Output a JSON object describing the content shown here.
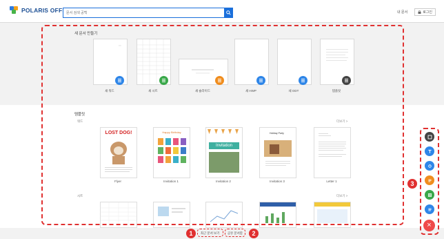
{
  "header": {
    "logo_text": "POLARIS OFFICE",
    "search_placeholder": "문서 검색 공백",
    "notifications_label": "내 문서",
    "login_label": "로그인"
  },
  "new_docs": {
    "title": "새 문서 만들기",
    "items": [
      {
        "label": "새 워드",
        "color": "#2f86e8"
      },
      {
        "label": "새 시트",
        "color": "#3aa84a"
      },
      {
        "label": "새 슬라이드",
        "color": "#f08d1e"
      },
      {
        "label": "새 HWP",
        "color": "#2f86e8"
      },
      {
        "label": "새 ODT",
        "color": "#2f86e8"
      },
      {
        "label": "템플릿",
        "color": "#444444"
      }
    ]
  },
  "templates": {
    "title": "템플릿",
    "group1": {
      "name": "워드",
      "more": "더보기 >",
      "items": [
        {
          "label": "Flyer",
          "headline": "LOST DOG!"
        },
        {
          "label": "Invitation 1",
          "headline": "Happy Birthday"
        },
        {
          "label": "Invitation 2",
          "headline": "Invitation"
        },
        {
          "label": "Invitation 3",
          "headline": "Holiday Party"
        },
        {
          "label": "Letter 1",
          "headline": ""
        }
      ]
    },
    "group2": {
      "name": "시트",
      "more": "더보기 >"
    }
  },
  "bottom": {
    "link1": "최근 문서 보기",
    "link2": "공유 문서함"
  },
  "markers": {
    "m1": "1",
    "m2": "2",
    "m3": "3"
  },
  "fab": {
    "items": [
      {
        "name": "template",
        "color": "#444444"
      },
      {
        "name": "odt",
        "color": "#2f86e8"
      },
      {
        "name": "hwp",
        "color": "#2f86e8"
      },
      {
        "name": "slide",
        "color": "#f08d1e"
      },
      {
        "name": "sheet",
        "color": "#3aa84a"
      },
      {
        "name": "word",
        "color": "#2f86e8"
      }
    ],
    "close_symbol": "×"
  }
}
